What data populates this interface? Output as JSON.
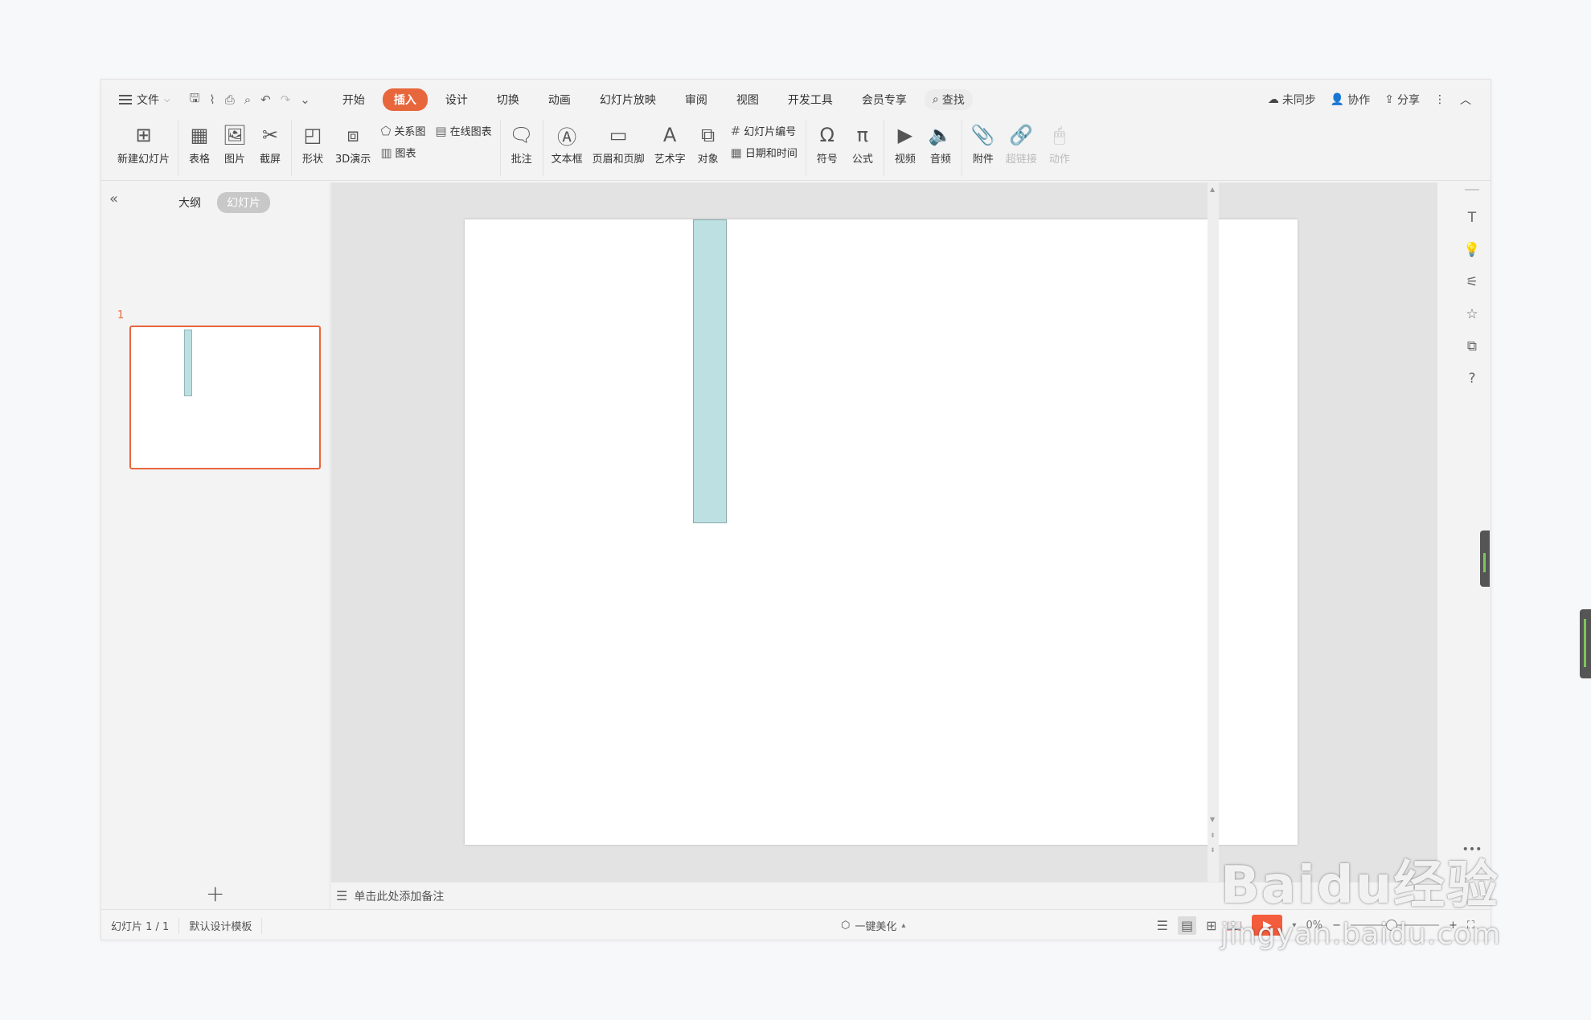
{
  "menubar": {
    "file_label": "文件",
    "tabs": [
      {
        "label": "开始"
      },
      {
        "label": "插入"
      },
      {
        "label": "设计"
      },
      {
        "label": "切换"
      },
      {
        "label": "动画"
      },
      {
        "label": "幻灯片放映"
      },
      {
        "label": "审阅"
      },
      {
        "label": "视图"
      },
      {
        "label": "开发工具"
      },
      {
        "label": "会员专享"
      }
    ],
    "active_tab": "插入",
    "search_label": "查找",
    "right": {
      "sync_label": "未同步",
      "collab_label": "协作",
      "share_label": "分享"
    }
  },
  "ribbon": {
    "new_slide": "新建幻灯片",
    "table": "表格",
    "picture": "图片",
    "screenshot": "截屏",
    "shape": "形状",
    "demo3d": "3D演示",
    "relation": "关系图",
    "online_chart": "在线图表",
    "chart": "图表",
    "comment": "批注",
    "textbox": "文本框",
    "header_footer": "页眉和页脚",
    "wordart": "艺术字",
    "object": "对象",
    "slide_number": "幻灯片编号",
    "date_time": "日期和时间",
    "symbol": "符号",
    "formula": "公式",
    "video": "视频",
    "audio": "音频",
    "attachment": "附件",
    "hyperlink": "超链接",
    "action": "动作"
  },
  "leftpanel": {
    "outline_label": "大纲",
    "slides_label": "幻灯片",
    "slide_number": "1"
  },
  "notes": {
    "placeholder": "单击此处添加备注"
  },
  "statusbar": {
    "slide_info": "幻灯片 1 / 1",
    "template": "默认设计模板",
    "beautify": "一键美化",
    "zoom": "0%"
  },
  "watermark": {
    "brand": "Baidu经验",
    "url": "jingyan.baidu.com"
  },
  "colors": {
    "accent": "#e8663c",
    "shape_fill": "#bde0e3",
    "play": "#f35c3d"
  }
}
